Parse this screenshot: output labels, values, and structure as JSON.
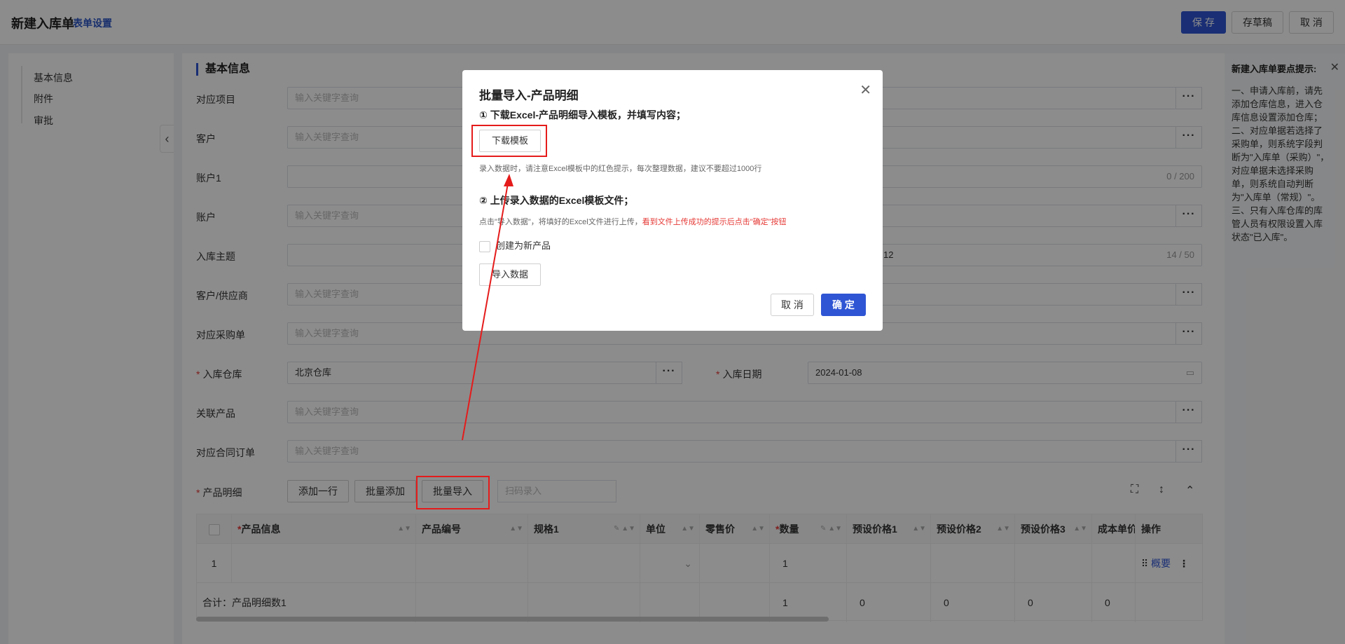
{
  "header": {
    "title": "新建入库单",
    "form_settings": "表单设置",
    "save": "保 存",
    "draft": "存草稿",
    "cancel": "取 消"
  },
  "leftnav": {
    "items": [
      "基本信息",
      "附件",
      "审批"
    ]
  },
  "section": {
    "title": "基本信息"
  },
  "fields": {
    "project": {
      "label": "对应项目",
      "placeholder": "输入关键字查询"
    },
    "customer": {
      "label": "客户",
      "placeholder": "输入关键字查询"
    },
    "account1": {
      "label": "账户1",
      "counter": "0 / 200"
    },
    "account": {
      "label": "账户",
      "placeholder": "输入关键字查询"
    },
    "subject": {
      "label": "入库主题",
      "value_tail": "12",
      "counter": "14 / 50"
    },
    "supplier": {
      "label": "客户/供应商",
      "placeholder": "输入关键字查询"
    },
    "purchase": {
      "label": "对应采购单",
      "placeholder": "输入关键字查询"
    },
    "warehouse": {
      "label": "入库仓库",
      "value": "北京仓库",
      "required": "*"
    },
    "date": {
      "label": "入库日期",
      "value": "2024-01-08",
      "required": "*"
    },
    "product": {
      "label": "关联产品",
      "placeholder": "输入关键字查询"
    },
    "contract": {
      "label": "对应合同订单",
      "placeholder": "输入关键字查询"
    },
    "details": {
      "label": "产品明细",
      "required": "*"
    }
  },
  "detail_toolbar": {
    "add_row": "添加一行",
    "batch_add": "批量添加",
    "batch_import": "批量导入",
    "scan_placeholder": "扫码录入"
  },
  "table": {
    "columns": [
      {
        "label": "产品信息",
        "required": "*"
      },
      {
        "label": "产品编号"
      },
      {
        "label": "规格1"
      },
      {
        "label": "单位"
      },
      {
        "label": "零售价"
      },
      {
        "label": "数量",
        "required": "*"
      },
      {
        "label": "预设价格1"
      },
      {
        "label": "预设价格2"
      },
      {
        "label": "预设价格3"
      },
      {
        "label": "成本单价"
      },
      {
        "label": "操作"
      }
    ],
    "row1": {
      "index": "1",
      "quantity": "1",
      "action_link": "概要"
    },
    "total": {
      "label": "合计：产品明细数1",
      "quantity": "1",
      "p1": "0",
      "p2": "0",
      "p3": "0",
      "cost": "0"
    }
  },
  "tips": {
    "title": "新建入库单要点提示:",
    "body": "一、申请入库前，请先添加仓库信息，进入仓库信息设置添加仓库；二、对应单据若选择了采购单，则系统字段判断为\"入库单（采购）\"，对应单据未选择采购单，则系统自动判断为\"入库单（常规）\"。三、只有入库仓库的库管人员有权限设置入库状态\"已入库\"。"
  },
  "modal": {
    "title": "批量导入-产品明细",
    "step1": "① 下载Excel-产品明细导入模板，并填写内容；",
    "download_btn": "下载模板",
    "note1": "录入数据时，请注意Excel模板中的红色提示，每次整理数据，建议不要超过1000行",
    "step2": "② 上传录入数据的Excel模板文件；",
    "note2_plain": "点击\"导入数据\"，将填好的Excel文件进行上传，",
    "note2_red": "看到文件上传成功的提示后点击\"确定\"按钮",
    "create_new": "创建为新产品",
    "import_btn": "导入数据",
    "cancel": "取 消",
    "ok": "确 定"
  },
  "colors": {
    "accent": "#2f55d4",
    "annotation": "#e51b1b",
    "required": "#e53935"
  }
}
